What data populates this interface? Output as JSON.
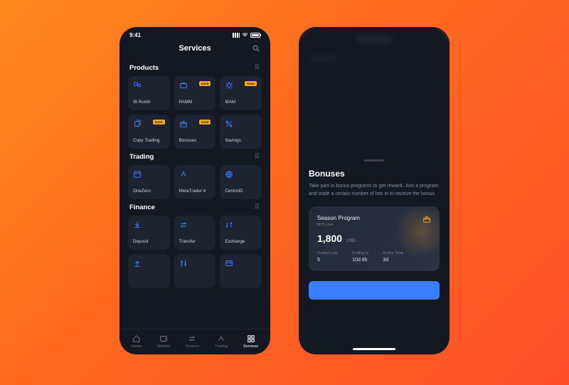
{
  "statusbar": {
    "time": "9:41"
  },
  "screen1": {
    "title": "Services",
    "sections": [
      {
        "title": "Products",
        "tiles": [
          {
            "label": "IB Room",
            "icon": "people",
            "badge": null
          },
          {
            "label": "PAMM",
            "icon": "briefcase",
            "badge": "soon"
          },
          {
            "label": "MAM",
            "icon": "gear",
            "badge": "soon"
          },
          {
            "label": "Copy Trading",
            "icon": "copy",
            "badge": "soon"
          },
          {
            "label": "Bonuses",
            "icon": "gift",
            "badge": "soon"
          },
          {
            "label": "Savings",
            "icon": "percent",
            "badge": null
          }
        ]
      },
      {
        "title": "Trading",
        "tiles": [
          {
            "label": "OneZero",
            "icon": "window",
            "badge": null
          },
          {
            "label": "MetaTrader 4",
            "icon": "arrows",
            "badge": null
          },
          {
            "label": "CentroID",
            "icon": "globe",
            "badge": null
          }
        ]
      },
      {
        "title": "Finance",
        "tiles": [
          {
            "label": "Deposit",
            "icon": "download",
            "badge": null
          },
          {
            "label": "Transfer",
            "icon": "swap",
            "badge": null
          },
          {
            "label": "Exchange",
            "icon": "exchange",
            "badge": null
          },
          {
            "label": "",
            "icon": "upload",
            "badge": null
          },
          {
            "label": "",
            "icon": "sliders",
            "badge": null
          },
          {
            "label": "",
            "icon": "card",
            "badge": null
          }
        ]
      }
    ],
    "tabs": [
      {
        "label": "Home",
        "active": false
      },
      {
        "label": "Wallets",
        "active": false
      },
      {
        "label": "Finance",
        "active": false
      },
      {
        "label": "Trading",
        "active": false
      },
      {
        "label": "Services",
        "active": true
      }
    ]
  },
  "screen2": {
    "sheet": {
      "title": "Bonuses",
      "body": "Take part in bonus programs to get reward. Join a program and trade a certain number of lots in to receive the bonus.",
      "card": {
        "title": "Season Program",
        "subtitle": "MT5 Live",
        "amount": "1,800",
        "currency": "USD",
        "stats": [
          {
            "label": "Traded Lots",
            "value": "5"
          },
          {
            "label": "Ending In",
            "value": "10d 6h"
          },
          {
            "label": "Active Time",
            "value": "3d"
          }
        ]
      }
    }
  }
}
